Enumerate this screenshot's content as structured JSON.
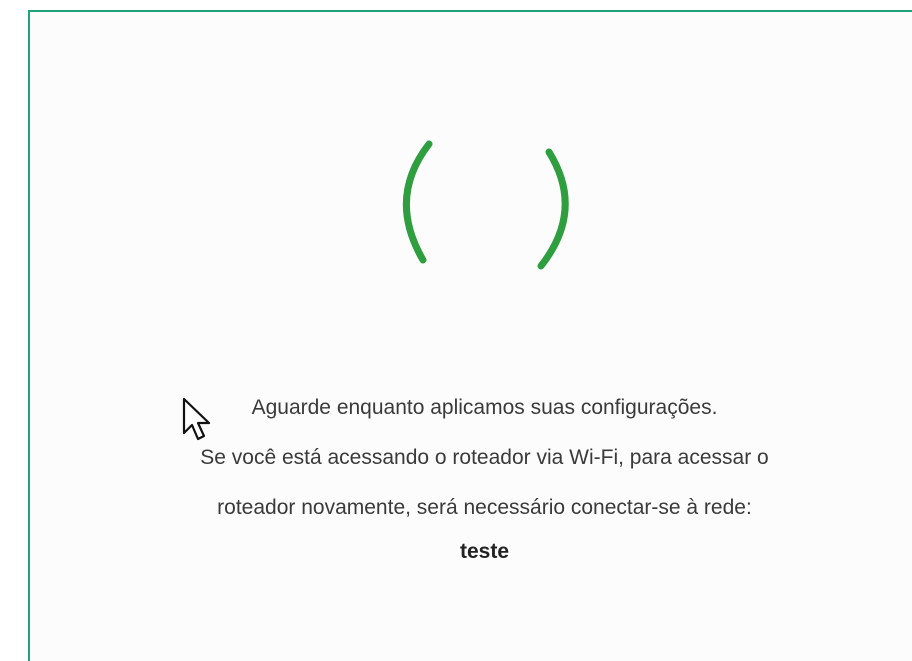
{
  "status": {
    "line1": "Aguarde enquanto aplicamos suas configurações.",
    "line2": "Se você está acessando o roteador via Wi-Fi, para acessar o",
    "line3": "roteador novamente, será necessário conectar-se à rede:",
    "network_name": "teste"
  },
  "spinner": {
    "icon": "loading-spinner-icon",
    "color": "#2e9e3e"
  },
  "panel": {
    "border_color": "#1fa37a"
  },
  "cursor": {
    "icon": "mouse-pointer-icon"
  }
}
